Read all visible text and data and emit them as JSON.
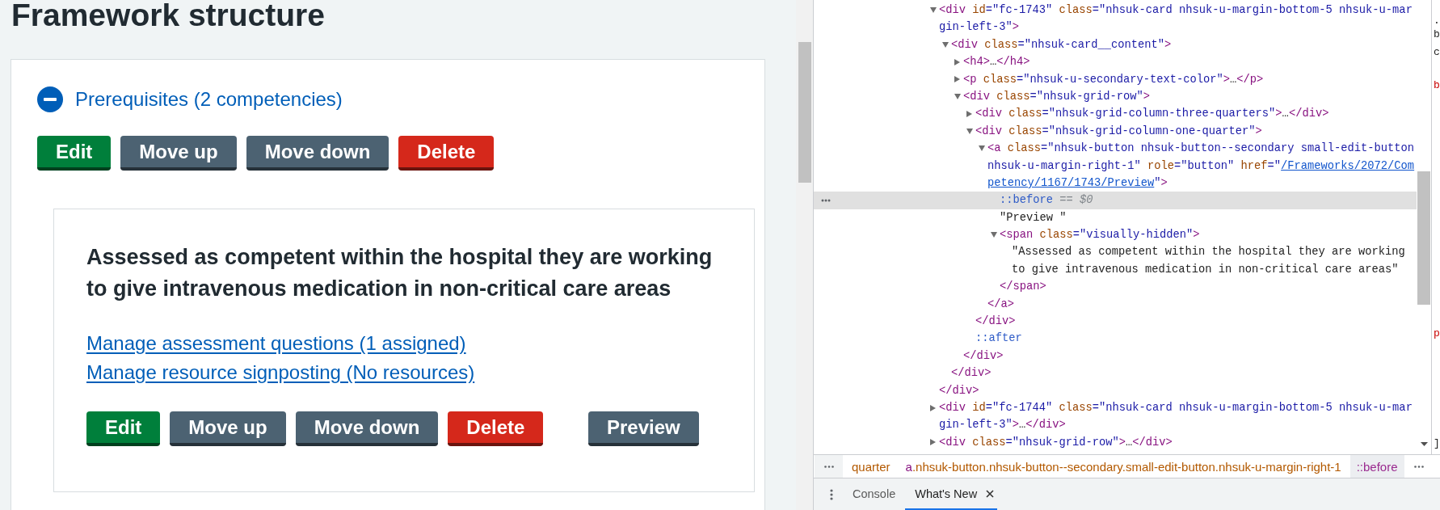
{
  "page": {
    "title": "Framework structure"
  },
  "competency_group": {
    "title": "Prerequisites (2 competencies)",
    "expanded": true,
    "actions": [
      {
        "label": "Edit",
        "kind": "primary"
      },
      {
        "label": "Move up",
        "kind": "secondary"
      },
      {
        "label": "Move down",
        "kind": "secondary"
      },
      {
        "label": "Delete",
        "kind": "warning"
      }
    ],
    "competency": {
      "title": "Assessed as competent within the hospital they are working to give intravenous medication in non-critical care areas",
      "links": [
        "Manage assessment questions (1 assigned)",
        "Manage resource signposting (No resources)"
      ],
      "actions": [
        {
          "label": "Edit",
          "kind": "primary"
        },
        {
          "label": "Move up",
          "kind": "secondary"
        },
        {
          "label": "Move down",
          "kind": "secondary"
        },
        {
          "label": "Delete",
          "kind": "warning"
        }
      ],
      "side_actions": [
        {
          "label": "Preview",
          "kind": "secondary"
        }
      ]
    }
  },
  "devtools": {
    "dom_tree": [
      {
        "expanded": true,
        "selected": false,
        "lines": [
          [
            {
              "kind": "tag",
              "text": "<div"
            },
            {
              "kind": "attr",
              "text": " id"
            },
            {
              "kind": "value",
              "text": "=\"fc-1743\""
            },
            {
              "kind": "attr",
              "text": " class"
            },
            {
              "kind": "value",
              "text": "=\"nhsuk-card nhsuk-u-margin-bottom-5 nhsuk-u-mar"
            }
          ],
          [
            {
              "kind": "value",
              "text": "gin-left-3\""
            },
            {
              "kind": "tag",
              "text": ">"
            }
          ]
        ],
        "children": [
          {
            "expanded": true,
            "selected": false,
            "lines": [
              [
                {
                  "kind": "tag",
                  "text": "<div"
                },
                {
                  "kind": "attr",
                  "text": " class"
                },
                {
                  "kind": "value",
                  "text": "=\"nhsuk-card__content\""
                },
                {
                  "kind": "tag",
                  "text": ">"
                }
              ]
            ],
            "children": [
              {
                "expanded": false,
                "selected": false,
                "lines": [
                  [
                    {
                      "kind": "tag",
                      "text": "<h4>"
                    },
                    {
                      "kind": "text",
                      "text": "…"
                    },
                    {
                      "kind": "tag",
                      "text": "</h4>"
                    }
                  ]
                ]
              },
              {
                "expanded": false,
                "selected": false,
                "lines": [
                  [
                    {
                      "kind": "tag",
                      "text": "<p"
                    },
                    {
                      "kind": "attr",
                      "text": " class"
                    },
                    {
                      "kind": "value",
                      "text": "=\"nhsuk-u-secondary-text-color\""
                    },
                    {
                      "kind": "tag",
                      "text": ">"
                    },
                    {
                      "kind": "text",
                      "text": "…"
                    },
                    {
                      "kind": "tag",
                      "text": "</p>"
                    }
                  ]
                ]
              },
              {
                "expanded": true,
                "selected": false,
                "lines": [
                  [
                    {
                      "kind": "tag",
                      "text": "<div"
                    },
                    {
                      "kind": "attr",
                      "text": " class"
                    },
                    {
                      "kind": "value",
                      "text": "=\"nhsuk-grid-row\""
                    },
                    {
                      "kind": "tag",
                      "text": ">"
                    }
                  ]
                ],
                "children": [
                  {
                    "expanded": false,
                    "selected": false,
                    "lines": [
                      [
                        {
                          "kind": "tag",
                          "text": "<div"
                        },
                        {
                          "kind": "attr",
                          "text": " class"
                        },
                        {
                          "kind": "value",
                          "text": "=\"nhsuk-grid-column-three-quarters\""
                        },
                        {
                          "kind": "tag",
                          "text": ">"
                        },
                        {
                          "kind": "text",
                          "text": "…"
                        },
                        {
                          "kind": "tag",
                          "text": "</div>"
                        }
                      ]
                    ]
                  },
                  {
                    "expanded": true,
                    "selected": false,
                    "lines": [
                      [
                        {
                          "kind": "tag",
                          "text": "<div"
                        },
                        {
                          "kind": "attr",
                          "text": " class"
                        },
                        {
                          "kind": "value",
                          "text": "=\"nhsuk-grid-column-one-quarter\""
                        },
                        {
                          "kind": "tag",
                          "text": ">"
                        }
                      ]
                    ],
                    "children": [
                      {
                        "expanded": true,
                        "selected": false,
                        "lines": [
                          [
                            {
                              "kind": "tag",
                              "text": "<a"
                            },
                            {
                              "kind": "attr",
                              "text": " class"
                            },
                            {
                              "kind": "value",
                              "text": "=\"nhsuk-button nhsuk-button--secondary small-edit-button"
                            }
                          ],
                          [
                            {
                              "kind": "value",
                              "text": "nhsuk-u-margin-right-1\""
                            },
                            {
                              "kind": "attr",
                              "text": " role"
                            },
                            {
                              "kind": "value",
                              "text": "=\"button\""
                            },
                            {
                              "kind": "attr",
                              "text": " href"
                            },
                            {
                              "kind": "value",
                              "text": "=\""
                            },
                            {
                              "kind": "link",
                              "text": "/Frameworks/2072/Com"
                            }
                          ],
                          [
                            {
                              "kind": "link",
                              "text": "petency/1167/1743/Preview"
                            },
                            {
                              "kind": "value",
                              "text": "\""
                            },
                            {
                              "kind": "tag",
                              "text": ">"
                            }
                          ]
                        ],
                        "children": [
                          {
                            "selected": true,
                            "lines": [
                              [
                                {
                                  "kind": "pseudo",
                                  "text": "::before"
                                },
                                {
                                  "kind": "note",
                                  "text": " == "
                                },
                                {
                                  "kind": "ref",
                                  "text": "$0"
                                }
                              ]
                            ]
                          },
                          {
                            "selected": false,
                            "lines": [
                              [
                                {
                                  "kind": "text",
                                  "text": "\"Preview \""
                                }
                              ]
                            ]
                          },
                          {
                            "expanded": true,
                            "selected": false,
                            "lines": [
                              [
                                {
                                  "kind": "tag",
                                  "text": "<span"
                                },
                                {
                                  "kind": "attr",
                                  "text": " class"
                                },
                                {
                                  "kind": "value",
                                  "text": "=\"visually-hidden\""
                                },
                                {
                                  "kind": "tag",
                                  "text": ">"
                                }
                              ]
                            ],
                            "children": [
                              {
                                "selected": false,
                                "lines": [
                                  [
                                    {
                                      "kind": "text",
                                      "text": "\"Assessed as competent within the hospital they are working"
                                    }
                                  ],
                                  [
                                    {
                                      "kind": "text",
                                      "text": "to give intravenous medication in non-critical care areas\""
                                    }
                                  ]
                                ]
                              }
                            ],
                            "close": [
                              {
                                "kind": "tag",
                                "text": "</span>"
                              }
                            ]
                          }
                        ],
                        "close": [
                          {
                            "kind": "tag",
                            "text": "</a>"
                          }
                        ]
                      }
                    ],
                    "close": [
                      {
                        "kind": "tag",
                        "text": "</div>"
                      }
                    ]
                  },
                  {
                    "selected": false,
                    "lines": [
                      [
                        {
                          "kind": "pseudo",
                          "text": "::after"
                        }
                      ]
                    ]
                  }
                ],
                "close": [
                  {
                    "kind": "tag",
                    "text": "</div>"
                  }
                ]
              }
            ],
            "close": [
              {
                "kind": "tag",
                "text": "</div>"
              }
            ]
          }
        ],
        "close": [
          {
            "kind": "tag",
            "text": "</div>"
          }
        ]
      },
      {
        "expanded": false,
        "selected": false,
        "lines": [
          [
            {
              "kind": "tag",
              "text": "<div"
            },
            {
              "kind": "attr",
              "text": " id"
            },
            {
              "kind": "value",
              "text": "=\"fc-1744\""
            },
            {
              "kind": "attr",
              "text": " class"
            },
            {
              "kind": "value",
              "text": "=\"nhsuk-card nhsuk-u-margin-bottom-5 nhsuk-u-mar"
            }
          ],
          [
            {
              "kind": "value",
              "text": "gin-left-3\""
            },
            {
              "kind": "tag",
              "text": ">"
            },
            {
              "kind": "text",
              "text": "…"
            },
            {
              "kind": "tag",
              "text": "</div>"
            }
          ]
        ]
      },
      {
        "expanded": false,
        "selected": false,
        "lines": [
          [
            {
              "kind": "tag",
              "text": "<div"
            },
            {
              "kind": "attr",
              "text": " class"
            },
            {
              "kind": "value",
              "text": "=\"nhsuk-grid-row\""
            },
            {
              "kind": "tag",
              "text": ">"
            },
            {
              "kind": "text",
              "text": "…"
            },
            {
              "kind": "tag",
              "text": "</div>"
            }
          ]
        ]
      }
    ],
    "styles_fragments": [
      {
        "text": ".",
        "kind": "plain"
      },
      {
        "text": "b",
        "kind": "plain"
      },
      {
        "text": "c",
        "kind": "plain"
      },
      {
        "text": "b",
        "kind": "property"
      },
      {
        "text": "p",
        "kind": "property"
      },
      {
        "text": "]",
        "kind": "plain"
      }
    ],
    "breadcrumbs": [
      {
        "selected": false,
        "parts": [
          {
            "kind": "class",
            "text": "quarter"
          }
        ]
      },
      {
        "selected": false,
        "parts": [
          {
            "kind": "tag",
            "text": "a"
          },
          {
            "kind": "class",
            "text": ".nhsuk-button.nhsuk-button--secondary.small-edit-button.nhsuk-u-margin-right-1"
          }
        ]
      },
      {
        "selected": true,
        "parts": [
          {
            "kind": "pseudo",
            "text": "::before"
          }
        ]
      }
    ],
    "drawer_tabs": [
      {
        "label": "Console",
        "selected": false,
        "closable": false
      },
      {
        "label": "What's New",
        "selected": true,
        "closable": true
      }
    ]
  }
}
